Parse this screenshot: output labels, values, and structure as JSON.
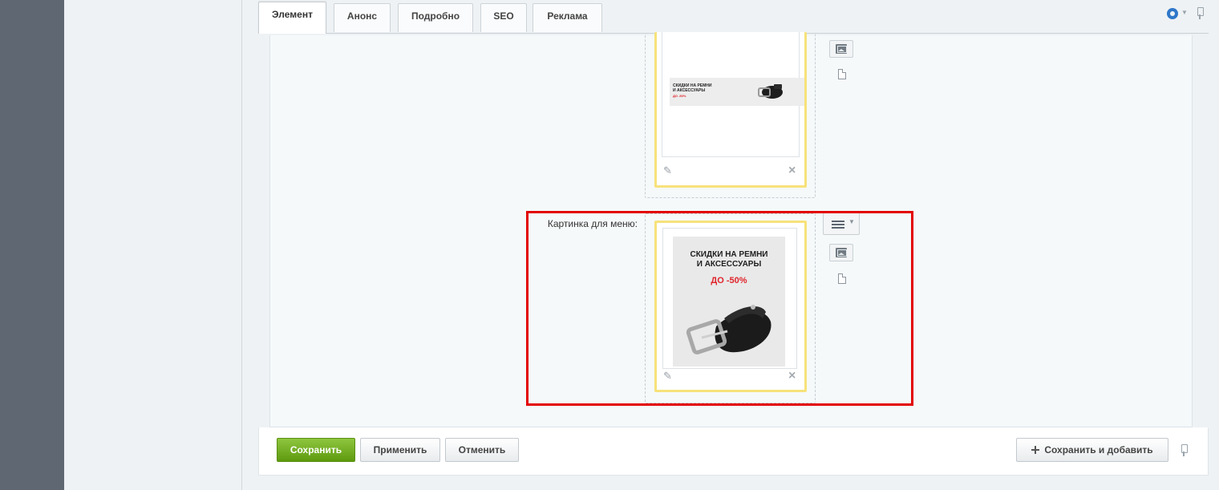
{
  "tabs": [
    {
      "label": "Элемент",
      "active": true
    },
    {
      "label": "Анонс",
      "active": false
    },
    {
      "label": "Подробно",
      "active": false
    },
    {
      "label": "SEO",
      "active": false
    },
    {
      "label": "Реклама",
      "active": false
    }
  ],
  "tab_tools": {
    "settings_icon": "gear-icon",
    "pin_icon": "pin-icon"
  },
  "upload_top": {
    "banner_line1": "СКИДКИ НА РЕМНИ",
    "banner_line2": "И АКСЕССУАРЫ",
    "banner_discount": "ДО -50%"
  },
  "menu_picture": {
    "label": "Картинка для меню:",
    "banner_line1": "СКИДКИ НА РЕМНИ",
    "banner_line2": "И АКСЕССУАРЫ",
    "banner_discount": "ДО -50%"
  },
  "footer": {
    "save_label": "Сохранить",
    "apply_label": "Применить",
    "cancel_label": "Отменить",
    "save_add_label": "Сохранить и добавить"
  },
  "colors": {
    "highlight": "#e30000",
    "save_button": "#6aa81b",
    "upload_border": "#f7e27a",
    "discount_text": "#e0242b",
    "settings_icon": "#2f77c9"
  }
}
